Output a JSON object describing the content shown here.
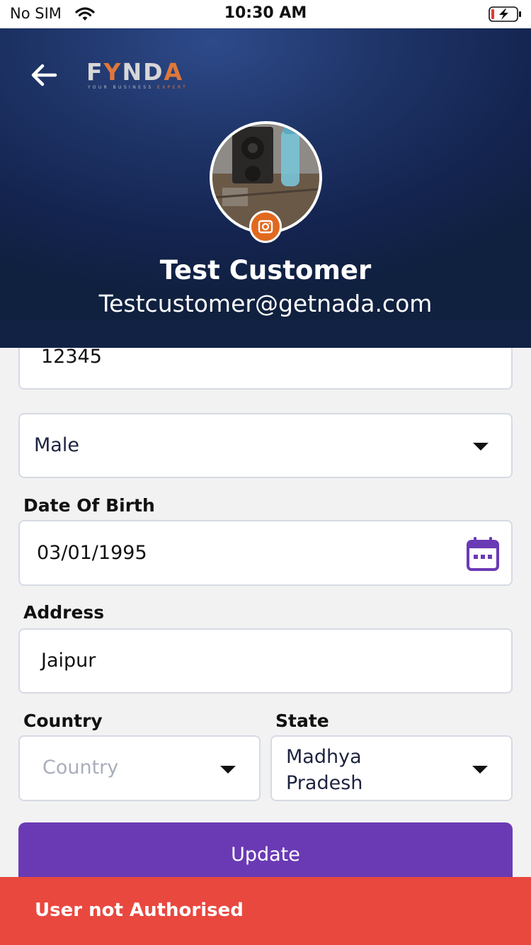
{
  "status_bar": {
    "carrier": "No SIM",
    "time": "10:30 AM",
    "battery_state": "charging-low"
  },
  "header": {
    "logo_text_left": "F",
    "logo_text_accent": "Y",
    "logo_text_mid": "ND",
    "logo_text_end": "A",
    "logo_tagline": "YOUR BUSINESS",
    "logo_tagline_accent": "EXPERT",
    "back_icon": "arrow-left-icon",
    "profile_name": "Test Customer",
    "profile_email": "Testcustomer@getnada.com",
    "camera_icon": "camera-icon"
  },
  "form": {
    "pincode_value": "12345",
    "gender_value": "Male",
    "dob_label": "Date Of Birth",
    "dob_value": "03/01/1995",
    "calendar_icon": "calendar-icon",
    "address_label": "Address",
    "address_value": "Jaipur",
    "country_label": "Country",
    "country_placeholder": "Country",
    "state_label": "State",
    "state_value_line1": "Madhya",
    "state_value_line2": "Pradesh",
    "update_label": "Update"
  },
  "toast": {
    "message": "User not Authorised"
  },
  "colors": {
    "header_dark": "#142450",
    "accent_orange": "#e0691f",
    "primary_purple": "#6a3ab5",
    "error_red": "#e9483f"
  }
}
